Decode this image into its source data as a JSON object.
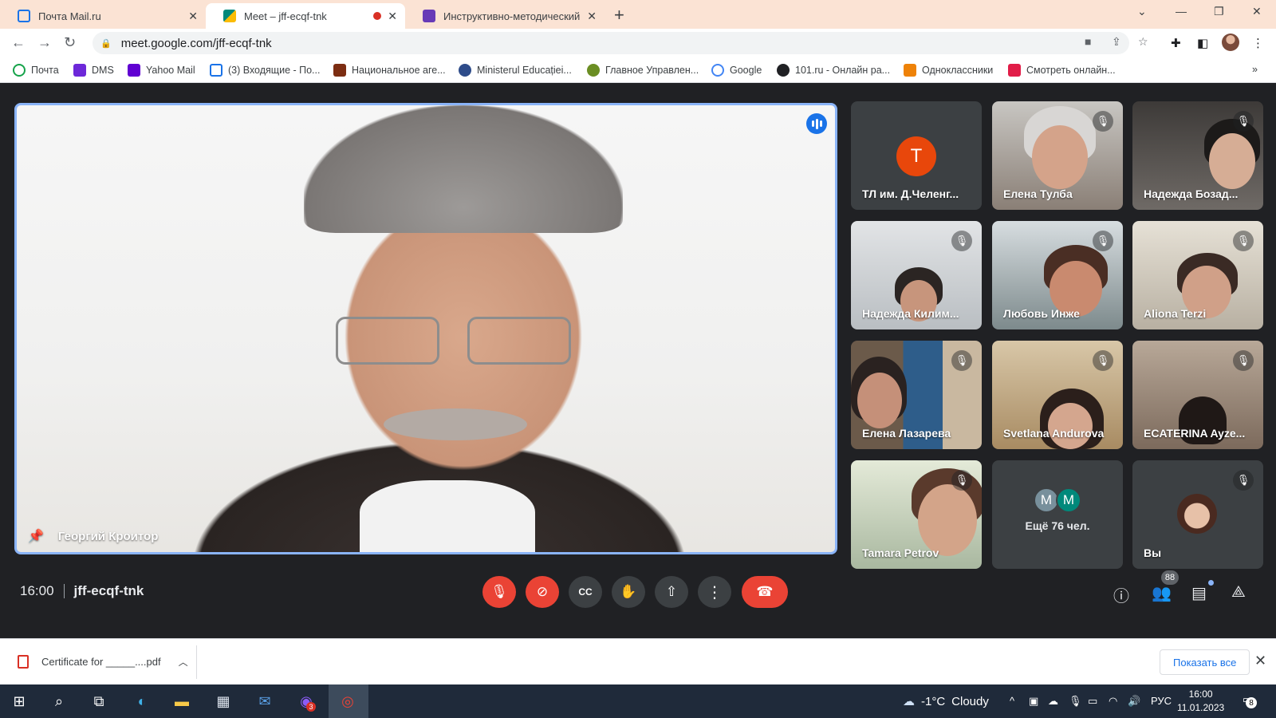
{
  "browser": {
    "tabs": [
      {
        "title": "Почта Mail.ru",
        "favicon_color": "#1a73e8"
      },
      {
        "title": "Meet – jff-ecqf-tnk",
        "favicon_color": "#00897b",
        "recording": true
      },
      {
        "title": "Инструктивно-методический се",
        "favicon_color": "#673ab7"
      }
    ],
    "url": "meet.google.com/jff-ecqf-tnk",
    "bookmarks": [
      {
        "label": "Почта",
        "color": "#16a34a"
      },
      {
        "label": "DMS",
        "color": "#6d28d9"
      },
      {
        "label": "Yahoo Mail",
        "color": "#6001d2"
      },
      {
        "label": "(3) Входящие - По...",
        "color": "#1a73e8"
      },
      {
        "label": "Национальное аге...",
        "color": "#7c2d12"
      },
      {
        "label": "Ministerul Educației...",
        "color": "#2e4c8a"
      },
      {
        "label": "Главное Управлен...",
        "color": "#6b8e23"
      },
      {
        "label": "Google",
        "color": "#4285f4"
      },
      {
        "label": "101.ru - Онлайн ра...",
        "color": "#202124"
      },
      {
        "label": "Одноклассники",
        "color": "#ee8208"
      },
      {
        "label": "Смотреть онлайн...",
        "color": "#e11d48"
      }
    ],
    "bookmarks_overflow": "»"
  },
  "meet": {
    "main_speaker": "Георгий Кроитор",
    "participants": [
      {
        "name": "ТЛ им. Д.Челенг...",
        "avatar_letter": "T",
        "avatar_color": "#e8470b",
        "muted": false
      },
      {
        "name": "Елена Тулба",
        "muted": true
      },
      {
        "name": "Надежда Бозад...",
        "muted": true
      },
      {
        "name": "Надежда Килим...",
        "muted": true
      },
      {
        "name": "Любовь Инже",
        "muted": true
      },
      {
        "name": "Aliona Terzi",
        "muted": true
      },
      {
        "name": "Елена Лазарева",
        "muted": true
      },
      {
        "name": "Svetlana Andurova",
        "muted": true
      },
      {
        "name": "ECATERINA Ayze...",
        "muted": true
      },
      {
        "name": "Tamara Petrov",
        "muted": true
      }
    ],
    "more": {
      "avatars": [
        {
          "letter": "M",
          "color": "#78909c"
        },
        {
          "letter": "M",
          "color": "#00897b"
        }
      ],
      "label": "Ещё 76 чел."
    },
    "self_tile": {
      "name": "Вы",
      "muted": true
    },
    "time": "16:00",
    "meeting_code": "jff-ecqf-tnk",
    "people_count": "88",
    "controls": [
      "mic-off",
      "camera-off",
      "captions",
      "raise-hand",
      "present",
      "more-options",
      "leave-call"
    ]
  },
  "downloads": {
    "file": "Certificate for _____....pdf",
    "show_all": "Показать все"
  },
  "taskbar": {
    "weather_temp": "-1°C",
    "weather_text": "Cloudy",
    "lang": "РУС",
    "time": "16:00",
    "date": "11.01.2023",
    "notification_count": "8",
    "viber_count": "3"
  }
}
